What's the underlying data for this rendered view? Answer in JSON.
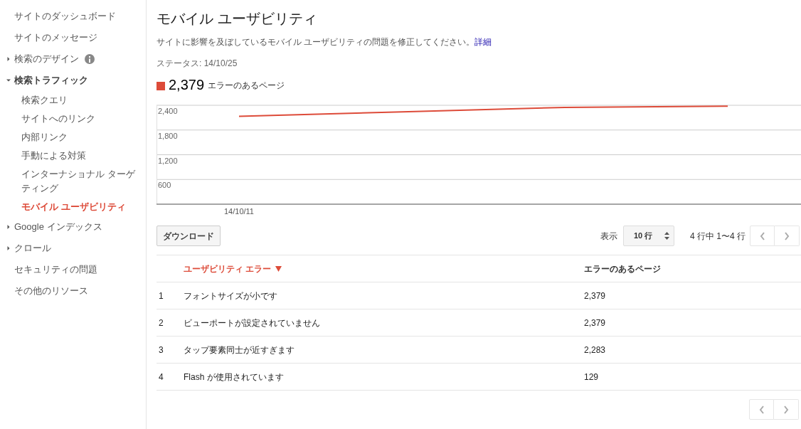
{
  "sidebar": {
    "items": [
      {
        "label": "サイトのダッシュボード",
        "kind": "link"
      },
      {
        "label": "サイトのメッセージ",
        "kind": "link"
      },
      {
        "label": "検索のデザイン",
        "kind": "group",
        "expanded": false,
        "info": true
      },
      {
        "label": "検索トラフィック",
        "kind": "group",
        "expanded": true,
        "children": [
          {
            "label": "検索クエリ",
            "selected": false
          },
          {
            "label": "サイトへのリンク",
            "selected": false
          },
          {
            "label": "内部リンク",
            "selected": false
          },
          {
            "label": "手動による対策",
            "selected": false
          },
          {
            "label": "インターナショナル ターゲティング",
            "selected": false
          },
          {
            "label": "モバイル ユーザビリティ",
            "selected": true
          }
        ]
      },
      {
        "label": "Google インデックス",
        "kind": "group",
        "expanded": false
      },
      {
        "label": "クロール",
        "kind": "group",
        "expanded": false
      },
      {
        "label": "セキュリティの問題",
        "kind": "link"
      },
      {
        "label": "その他のリソース",
        "kind": "link"
      }
    ]
  },
  "page": {
    "title": "モバイル ユーザビリティ",
    "description": "サイトに影響を及ぼしているモバイル ユーザビリティの問題を修正してください。",
    "details_link": "詳細",
    "status": "ステータス: 14/10/25"
  },
  "summary": {
    "count": "2,379"
  },
  "chart_data": {
    "type": "line",
    "grid": true,
    "series": [
      {
        "name": "エラーのあるページ",
        "color": "#dd4b39",
        "values": [
          2130,
          2240,
          2350,
          2380
        ]
      }
    ],
    "ylim": [
      0,
      2400
    ],
    "yticks": [
      {
        "value": 600,
        "label": "600"
      },
      {
        "value": 1200,
        "label": "1,200"
      },
      {
        "value": 1800,
        "label": "1,800"
      },
      {
        "value": 2400,
        "label": "2,400"
      }
    ],
    "annotations": [
      {
        "text": "14/10/11"
      }
    ]
  },
  "toolbar": {
    "download": "ダウンロード",
    "show_label": "表示",
    "rows_select": "10 行",
    "range": "4 行中 1〜4 行"
  },
  "table": {
    "columns": [
      {
        "label": "ユーザビリティ エラー",
        "sorted": true
      },
      {
        "label": "エラーのあるページ",
        "sorted": false
      }
    ],
    "rows": [
      {
        "index": "1",
        "error": "フォントサイズが小です",
        "pages": "2,379"
      },
      {
        "index": "2",
        "error": "ビューポートが設定されていません",
        "pages": "2,379"
      },
      {
        "index": "3",
        "error": "タップ要素同士が近すぎます",
        "pages": "2,283"
      },
      {
        "index": "4",
        "error": "Flash が使用されています",
        "pages": "129"
      }
    ]
  }
}
